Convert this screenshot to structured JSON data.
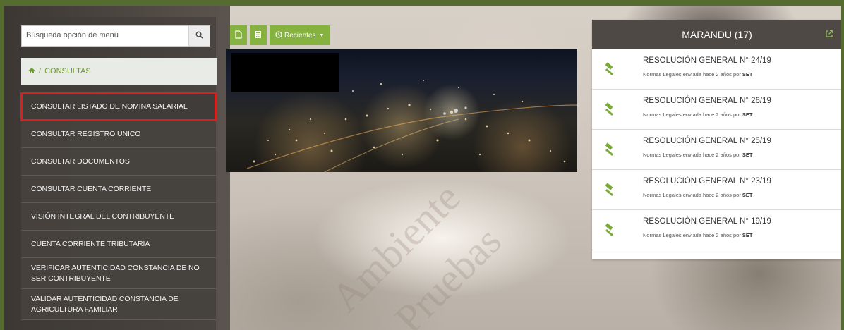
{
  "search": {
    "placeholder": "Búsqueda opción de menú",
    "icon": "search-icon"
  },
  "breadcrumb": {
    "separator": "/",
    "current": "CONSULTAS",
    "home_icon": "home-icon"
  },
  "menu": {
    "items": [
      {
        "label": "CONSULTAR LISTADO DE NOMINA SALARIAL",
        "selected": true
      },
      {
        "label": "CONSULTAR REGISTRO UNICO"
      },
      {
        "label": "CONSULTAR DOCUMENTOS"
      },
      {
        "label": "CONSULTAR CUENTA CORRIENTE"
      },
      {
        "label": "VISIÓN INTEGRAL DEL CONTRIBUYENTE"
      },
      {
        "label": "CUENTA CORRIENTE TRIBUTARIA"
      },
      {
        "label": "VERIFICAR AUTENTICIDAD CONSTANCIA DE NO SER CONTRIBUYENTE"
      },
      {
        "label": "VALIDAR AUTENTICIDAD CONSTANCIA DE AGRICULTURA FAMILIAR"
      }
    ]
  },
  "toolbar": {
    "new_doc_icon": "file-icon",
    "calculator_icon": "calculator-icon",
    "recent_icon": "clock-icon",
    "recent_label": "Recientes",
    "caret_icon": "caret-down-icon"
  },
  "watermark": {
    "line1": "Ambiente",
    "line2": "Pruebas"
  },
  "panel": {
    "title": "MARANDU (17)",
    "external_icon": "external-link-icon",
    "items": [
      {
        "title": "RESOLUCIÓN GENERAL N° 24/19",
        "prefix": "Normas Legales enviada hace 2 años por ",
        "author": "SET"
      },
      {
        "title": "RESOLUCIÓN GENERAL N° 26/19",
        "prefix": "Normas Legales enviada hace 2 años por ",
        "author": "SET"
      },
      {
        "title": "RESOLUCIÓN GENERAL N° 25/19",
        "prefix": "Normas Legales enviada hace 2 años por ",
        "author": "SET"
      },
      {
        "title": "RESOLUCIÓN GENERAL N° 23/19",
        "prefix": "Normas Legales enviada hace 2 años por ",
        "author": "SET"
      },
      {
        "title": "RESOLUCIÓN GENERAL N° 19/19",
        "prefix": "Normas Legales enviada hace 2 años por ",
        "author": "SET"
      }
    ]
  },
  "colors": {
    "accent_green": "#86b340",
    "selected_outline": "#d9201c",
    "panel_header": "#4e4945"
  }
}
